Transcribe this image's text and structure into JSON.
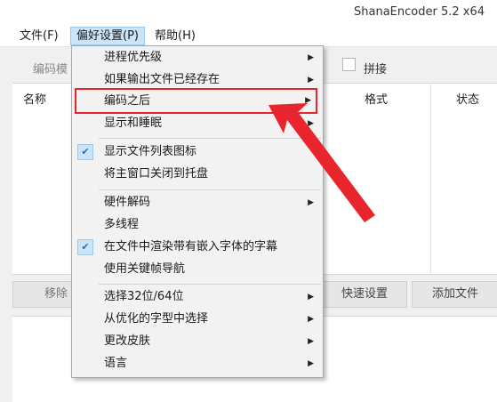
{
  "window": {
    "title": "ShanaEncoder 5.2 x64"
  },
  "menubar": {
    "items": [
      {
        "label": "文件(F)"
      },
      {
        "label": "偏好设置(P)"
      },
      {
        "label": "帮助(H)"
      }
    ]
  },
  "toolbar": {
    "encode_mode_label": "编码模",
    "splice_label": "拼接"
  },
  "file_list": {
    "columns": [
      "名称",
      "格式",
      "状态"
    ]
  },
  "buttons": {
    "remove": "移除",
    "quick_settings": "快速设置",
    "add_file": "添加文件"
  },
  "dropdown": {
    "items": [
      {
        "label": "进程优先级"
      },
      {
        "label": "如果输出文件已经存在"
      },
      {
        "label": "编码之后"
      },
      {
        "label": "显示和睡眠"
      },
      {
        "label": "显示文件列表图标"
      },
      {
        "label": "将主窗口关闭到托盘"
      },
      {
        "label": "硬件解码"
      },
      {
        "label": "多线程"
      },
      {
        "label": "在文件中渲染带有嵌入字体的字幕"
      },
      {
        "label": "使用关键帧导航"
      },
      {
        "label": "选择32位/64位"
      },
      {
        "label": "从优化的字型中选择"
      },
      {
        "label": "更改皮肤"
      },
      {
        "label": "语言"
      }
    ]
  },
  "colors": {
    "highlight_box": "#e8242c",
    "arrow": "#e8242c",
    "check_bg": "#cce4f7"
  }
}
